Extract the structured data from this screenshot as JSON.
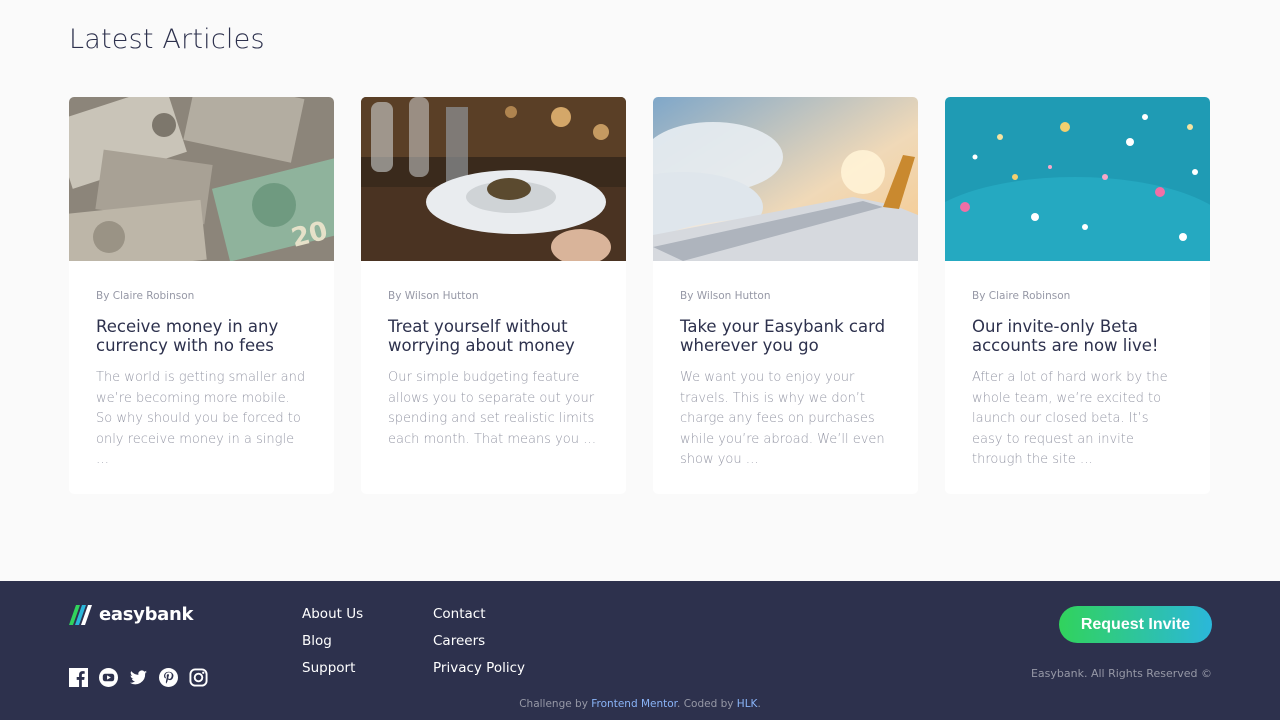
{
  "section": {
    "title": "Latest Articles"
  },
  "articles": [
    {
      "author": "By Claire Robinson",
      "title": "Receive money in any currency with no fees",
      "excerpt": "The world is getting smaller and we’re becoming more mobile. So why should you be forced to only receive money in a single …"
    },
    {
      "author": "By Wilson Hutton",
      "title": "Treat yourself without worrying about money",
      "excerpt": "Our simple budgeting feature allows you to separate out your spending and set realistic limits each month. That means you …"
    },
    {
      "author": "By Wilson Hutton",
      "title": "Take your Easybank card wherever you go",
      "excerpt": "We want you to enjoy your travels. This is why we don’t charge any fees on purchases while you’re abroad. We’ll even show you …"
    },
    {
      "author": "By Claire Robinson",
      "title": "Our invite-only Beta accounts are now live!",
      "excerpt": "After a lot of hard work by the whole team, we’re excited to launch our closed beta. It’s easy to request an invite through the site …"
    }
  ],
  "footer": {
    "logo_text": "easybank",
    "links_col1": [
      "About Us",
      "Blog",
      "Support"
    ],
    "links_col2": [
      "Contact",
      "Careers",
      "Privacy Policy"
    ],
    "cta_label": "Request Invite",
    "rights": "Easybank. All Rights Reserved ©",
    "attribution": {
      "prefix": "Challenge by",
      "mentor": "Frontend Mentor",
      "mid": ". Coded by",
      "author": "HLK",
      "suffix": "."
    },
    "socials": [
      "facebook-icon",
      "youtube-icon",
      "twitter-icon",
      "pinterest-icon",
      "instagram-icon"
    ]
  },
  "colors": {
    "navy": "#2d314d",
    "gray": "#9698a6",
    "green": "#31d35c",
    "cyan": "#2bb7da",
    "background": "#fafafa"
  }
}
